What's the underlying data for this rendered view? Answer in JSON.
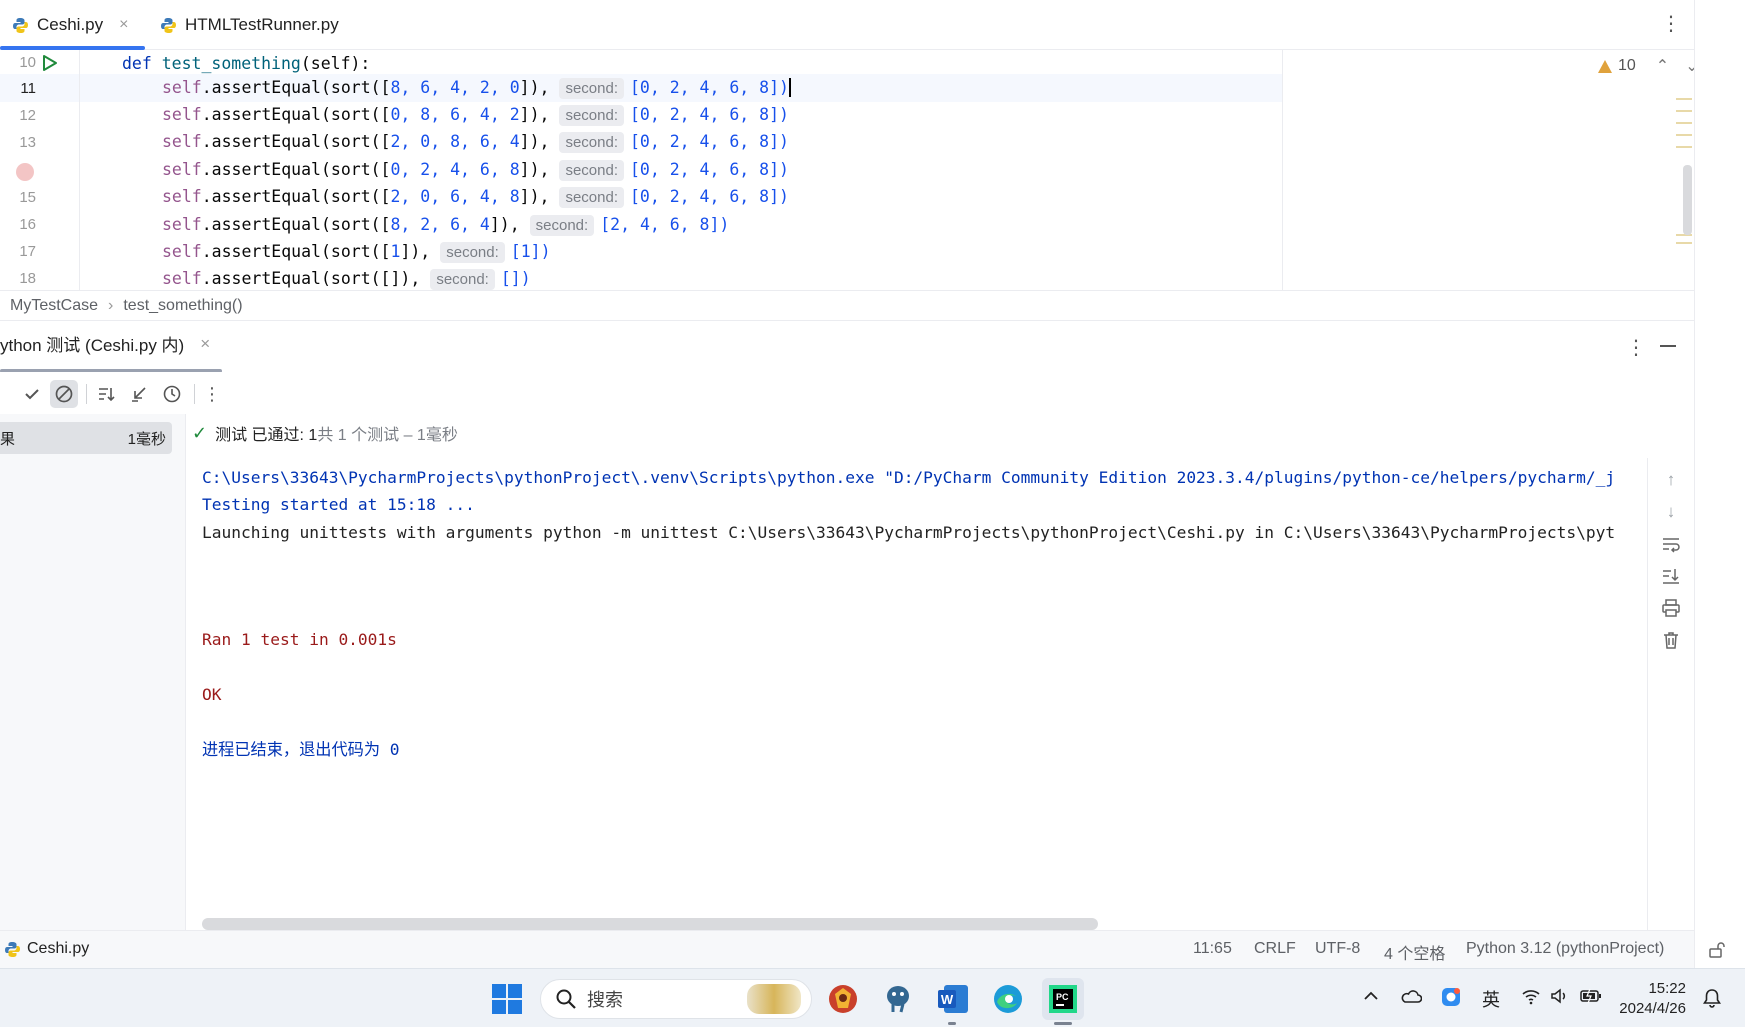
{
  "tabs": [
    {
      "label": "Ceshi.py",
      "close": "×",
      "active": true
    },
    {
      "label": "HTMLTestRunner.py",
      "active": false
    }
  ],
  "tab_menu": "⋮",
  "editor": {
    "line_numbers": [
      "10",
      "11",
      "12",
      "13",
      "",
      "15",
      "16",
      "17",
      "18"
    ],
    "current_line": "11",
    "lines": [
      {
        "indent": "",
        "kw": "def",
        "name": "test_something",
        "rest": "(self):"
      },
      {
        "self": "self",
        "call": ".assertEqual(sort([",
        "args": "8, 6, 4, 2, 0",
        "close": "]),",
        "hint": "second:",
        "expected": "[0, 2, 4, 6, 8])"
      },
      {
        "self": "self",
        "call": ".assertEqual(sort([",
        "args": "0, 8, 6, 4, 2",
        "close": "]),",
        "hint": "second:",
        "expected": "[0, 2, 4, 6, 8])"
      },
      {
        "self": "self",
        "call": ".assertEqual(sort([",
        "args": "2, 0, 8, 6, 4",
        "close": "]),",
        "hint": "second:",
        "expected": "[0, 2, 4, 6, 8])"
      },
      {
        "self": "self",
        "call": ".assertEqual(sort([",
        "args": "0, 2, 4, 6, 8",
        "close": "]),",
        "hint": "second:",
        "expected": "[0, 2, 4, 6, 8])"
      },
      {
        "self": "self",
        "call": ".assertEqual(sort([",
        "args": "2, 0, 6, 4, 8",
        "close": "]),",
        "hint": "second:",
        "expected": "[0, 2, 4, 6, 8])"
      },
      {
        "self": "self",
        "call": ".assertEqual(sort([",
        "args": "8, 2, 6, 4",
        "close": "]),",
        "hint": "second:",
        "expected": "[2, 4, 6, 8])"
      },
      {
        "self": "self",
        "call": ".assertEqual(sort([",
        "args": "1",
        "close": "]),",
        "hint": "second:",
        "expected": "[1])"
      },
      {
        "self": "self",
        "call": ".assertEqual(sort([",
        "args": "",
        "close": "]),",
        "hint": "second:",
        "expected": "[])"
      }
    ],
    "warning_count": "10",
    "warning_up": "⌃",
    "warning_down": "⌄"
  },
  "breadcrumb": {
    "class": "MyTestCase",
    "sep": "›",
    "method": "test_something()"
  },
  "run_panel": {
    "tab_label": "ython 测试 (Ceshi.py 内)",
    "tab_close": "×",
    "menu": "⋮",
    "tree_label": "果",
    "tree_time": "1毫秒",
    "status_check": "✓",
    "status_prefix": "测试 已通过: 1",
    "status_suffix": "共 1 个测试 – 1毫秒"
  },
  "console": {
    "line1": "C:\\Users\\33643\\PycharmProjects\\pythonProject\\.venv\\Scripts\\python.exe \"D:/PyCharm Community Edition 2023.3.4/plugins/python-ce/helpers/pycharm/_j",
    "line2": "Testing started at 15:18 ...",
    "line3": "Launching unittests with arguments python -m unittest C:\\Users\\33643\\PycharmProjects\\pythonProject\\Ceshi.py in C:\\Users\\33643\\PycharmProjects\\pyt",
    "line4": "Ran 1 test in 0.001s",
    "line5": "OK",
    "line6": "进程已结束，退出代码为 0"
  },
  "statusbar": {
    "file": "Ceshi.py",
    "position": "11:65",
    "line_sep": "CRLF",
    "encoding": "UTF-8",
    "indent": "4 个空格",
    "interpreter": "Python 3.12 (pythonProject)"
  },
  "taskbar": {
    "search_placeholder": "搜索",
    "ime": "英",
    "time": "15:22",
    "date": "2024/4/26"
  },
  "colors": {
    "accent": "#3574f0",
    "keyword": "#0033b3",
    "number": "#1750eb",
    "self": "#94558d",
    "console_red": "#9a1a1a",
    "success_green": "#208a3c"
  }
}
